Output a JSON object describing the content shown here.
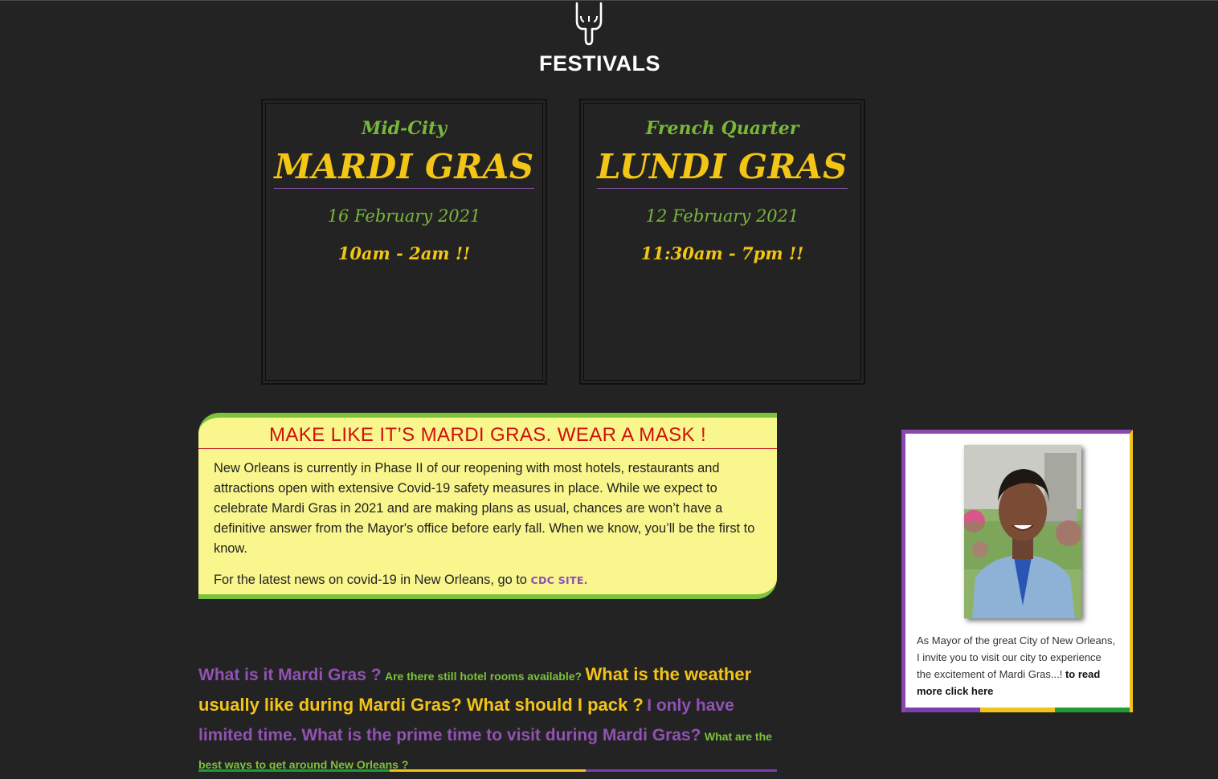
{
  "colors": {
    "background": "#232323",
    "purple": "#8d4fb1",
    "gold": "#f3c514",
    "green": "#7cc23b",
    "mask_bg": "#f8f68d",
    "mask_title": "#d10f0f"
  },
  "header": {
    "icon": "pointing-hand-down-icon",
    "title": "FESTIVALS"
  },
  "festivals": [
    {
      "location": "Mid-City",
      "event": "MARDI GRAS",
      "date": "16 February 2021",
      "time": "10am - 2am !!"
    },
    {
      "location": "French Quarter",
      "event": "LUNDI GRAS",
      "date": "12 February 2021",
      "time": "11:30am - 7pm !!"
    }
  ],
  "mask_notice": {
    "title": "MAKE LIKE IT’S MARDI GRAS. WEAR A MASK !",
    "body": "New Orleans is currently in Phase II of our reopening with most hotels, restaurants and attractions open with extensive Covid-19 safety measures in place. While we expect to celebrate Mardi Gras in 2021 and are making plans as usual, chances are won’t have a definitive answer from the Mayor's office before early fall. When we know, you’ll be the first to know.",
    "news_prefix": "For the latest news on covid-19 in New Orleans, go to ",
    "link_label": "CDC SITE."
  },
  "faq": {
    "q1": "What is it Mardi Gras ?",
    "q2": "Are there still hotel rooms available?",
    "q3": "What is the weather usually like during Mardi Gras? What should I pack ?",
    "q4": "I only have limited time. What is the prime time to visit during Mardi Gras?",
    "q5": "What are the best ways to get around New Orleans ?"
  },
  "mayor": {
    "photo": "mayor-portrait",
    "text": "As Mayor of the great City of New Orleans, I invite you to visit our city to experience the excitement of Mardi Gras...! ",
    "link_label": "to read more click here"
  }
}
